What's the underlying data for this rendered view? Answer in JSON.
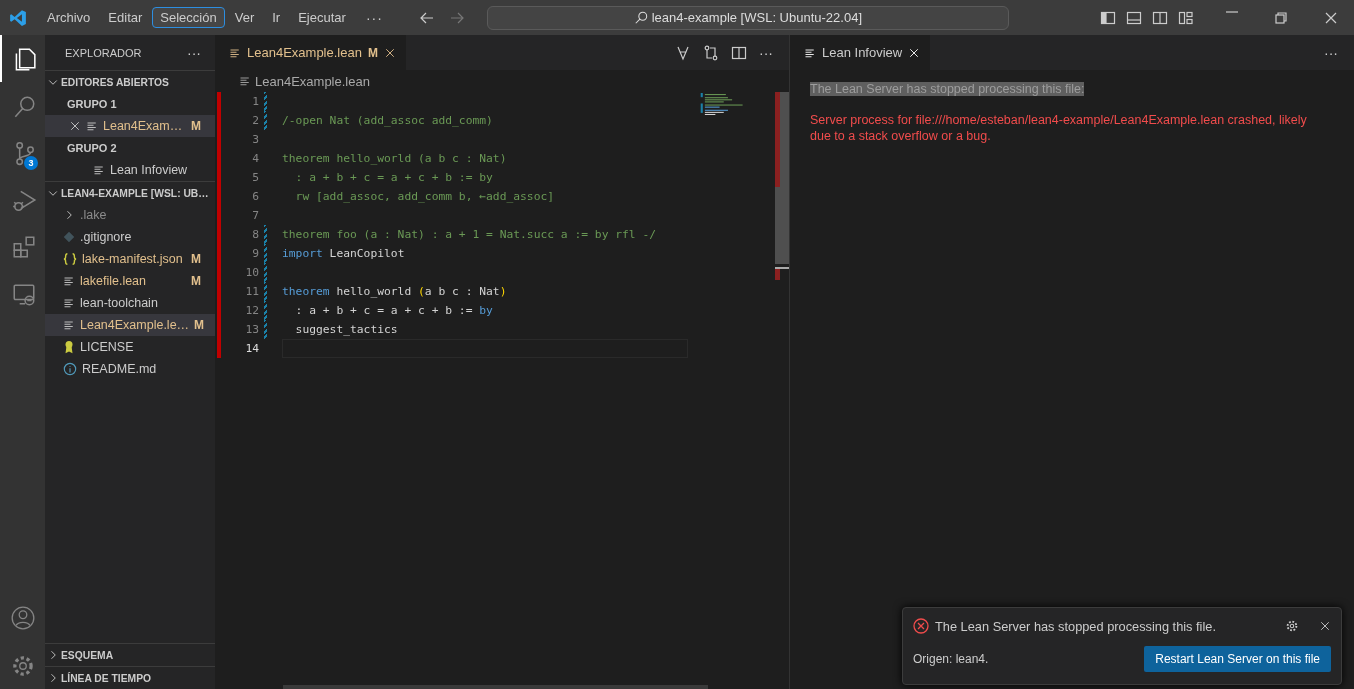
{
  "title_bar": {
    "menu": [
      {
        "label": "Archivo",
        "selected": false
      },
      {
        "label": "Editar",
        "selected": false
      },
      {
        "label": "Selección",
        "selected": true
      },
      {
        "label": "Ver",
        "selected": false
      },
      {
        "label": "Ir",
        "selected": false
      },
      {
        "label": "Ejecutar",
        "selected": false
      }
    ],
    "more": "···",
    "search": "lean4-example [WSL: Ubuntu-22.04]"
  },
  "activity_bar": {
    "items": [
      {
        "kind": "files",
        "selected": true
      },
      {
        "kind": "search",
        "selected": false
      },
      {
        "kind": "source-control",
        "selected": false,
        "badge": "3"
      },
      {
        "kind": "run",
        "selected": false
      },
      {
        "kind": "extensions",
        "selected": false
      },
      {
        "kind": "remote",
        "selected": false
      }
    ]
  },
  "sidebar": {
    "title": "EXPLORADOR",
    "more": "···",
    "open_editors": {
      "title": "EDITORES ABIERTOS",
      "expanded": true,
      "groups": [
        {
          "title": "GRUPO 1",
          "items": [
            {
              "label": "Lean4Exam…",
              "badge": "M",
              "selected": true,
              "modified": true
            }
          ]
        },
        {
          "title": "GRUPO 2",
          "items": [
            {
              "label": "Lean Infoview",
              "selected": false,
              "modified": false
            }
          ]
        }
      ]
    },
    "workspace": {
      "title": "LEAN4-EXAMPLE [WSL: UB…",
      "expanded": true,
      "items": [
        {
          "label": ".lake",
          "kind": "folder",
          "expanded": false,
          "selected": false,
          "modified": false,
          "dimmed": true
        },
        {
          "label": ".gitignore",
          "kind": "git",
          "selected": false,
          "modified": false,
          "dimmed": false
        },
        {
          "label": "lake-manifest.json",
          "kind": "json",
          "badge": "M",
          "selected": false,
          "modified": true,
          "dimmed": false
        },
        {
          "label": "lakefile.lean",
          "kind": "text",
          "badge": "M",
          "selected": false,
          "modified": true,
          "dimmed": false
        },
        {
          "label": "lean-toolchain",
          "kind": "text",
          "selected": false,
          "modified": false,
          "dimmed": false
        },
        {
          "label": "Lean4Example.le…",
          "kind": "text",
          "badge": "M",
          "selected": true,
          "modified": true,
          "dimmed": false
        },
        {
          "label": "LICENSE",
          "kind": "license",
          "selected": false,
          "modified": false,
          "dimmed": false
        },
        {
          "label": "README.md",
          "kind": "info",
          "selected": false,
          "modified": false,
          "dimmed": false
        }
      ]
    },
    "bottom_sections": [
      {
        "title": "ESQUEMA",
        "expanded": false
      },
      {
        "title": "LÍNEA DE TIEMPO",
        "expanded": false
      }
    ]
  },
  "editor": {
    "tab": {
      "label": "Lean4Example.lean",
      "badge": "M",
      "selected": true
    },
    "more": "···",
    "breadcrumb": "Lean4Example.lean",
    "lines": [
      {
        "number": "1",
        "changed": true,
        "current": false
      },
      {
        "number": "2",
        "changed": true,
        "current": false,
        "tokens": [
          {
            "kind": "comment",
            "text": "/-open Nat (add_assoc add_comm)"
          }
        ]
      },
      {
        "number": "3",
        "changed": false,
        "current": false
      },
      {
        "number": "4",
        "changed": false,
        "current": false,
        "tokens": [
          {
            "kind": "comment",
            "text": "theorem hello_world (a b c : Nat)"
          }
        ]
      },
      {
        "number": "5",
        "changed": false,
        "current": false,
        "tokens": [
          {
            "kind": "comment",
            "text": "  : a + b + c = a + c + b := by"
          }
        ]
      },
      {
        "number": "6",
        "changed": false,
        "current": false,
        "tokens": [
          {
            "kind": "comment",
            "text": "  rw [add_assoc, add_comm b, ←add_assoc]"
          }
        ]
      },
      {
        "number": "7",
        "changed": false,
        "current": false
      },
      {
        "number": "8",
        "changed": true,
        "current": false,
        "tokens": [
          {
            "kind": "comment",
            "text": "theorem foo (a : Nat) : a + 1 = Nat.succ a := by rfl -/"
          }
        ]
      },
      {
        "number": "9",
        "changed": true,
        "current": false,
        "tokens": [
          {
            "kind": "keyword",
            "text": "import"
          },
          {
            "kind": "plain",
            "text": " LeanCopilot"
          }
        ]
      },
      {
        "number": "10",
        "changed": true,
        "current": false
      },
      {
        "number": "11",
        "changed": true,
        "current": false,
        "tokens": [
          {
            "kind": "keyword",
            "text": "theorem"
          },
          {
            "kind": "plain",
            "text": " hello_world "
          },
          {
            "kind": "bracket",
            "text": "("
          },
          {
            "kind": "plain",
            "text": "a b c : Nat"
          },
          {
            "kind": "bracket",
            "text": ")"
          }
        ]
      },
      {
        "number": "12",
        "changed": true,
        "current": false,
        "tokens": [
          {
            "kind": "plain",
            "text": "  : a + b + c = a + c + b := "
          },
          {
            "kind": "keyword",
            "text": "by"
          }
        ]
      },
      {
        "number": "13",
        "changed": true,
        "current": false,
        "tokens": [
          {
            "kind": "plain",
            "text": "  suggest_tactics"
          }
        ]
      },
      {
        "number": "14",
        "changed": false,
        "current": true
      }
    ]
  },
  "infoview": {
    "tab": {
      "label": "Lean Infoview",
      "selected": true
    },
    "more": "···",
    "heading": "The Lean Server has stopped processing this file:",
    "error": "Server process for file:///home/esteban/lean4-example/Lean4Example.lean crashed, likely due to a stack overflow or a bug."
  },
  "notification": {
    "message": "The Lean Server has stopped processing this file.",
    "source": "Origen: lean4.",
    "action": "Restart Lean Server on this file"
  }
}
